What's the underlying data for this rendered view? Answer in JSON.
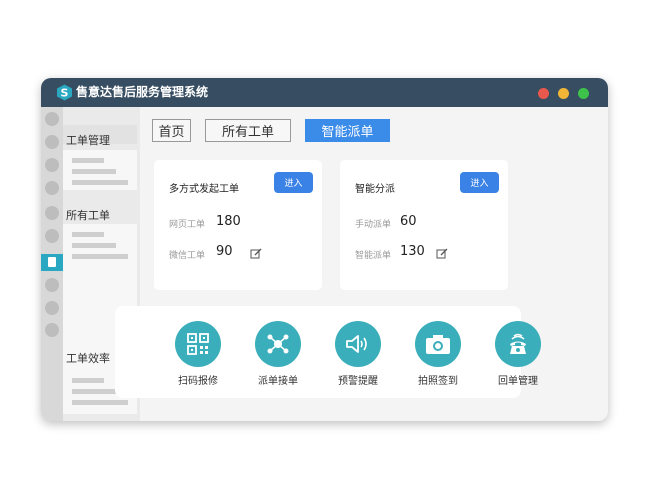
{
  "app": {
    "title": "售意达售后服务管理系统"
  },
  "window_controls": {
    "close_color": "#e9584d",
    "minimize_color": "#f2b637",
    "maximize_color": "#3ec34a"
  },
  "nav": {
    "sections": [
      {
        "label": "工单管理"
      },
      {
        "label": "所有工单"
      },
      {
        "label": "工单效率"
      }
    ]
  },
  "tabs": [
    {
      "label": "首页"
    },
    {
      "label": "所有工单"
    },
    {
      "label": "智能派单",
      "active": true
    }
  ],
  "cards": [
    {
      "title": "多方式发起工单",
      "button": "进入",
      "stats": [
        {
          "label": "网页工单",
          "value": "180"
        },
        {
          "label": "微信工单",
          "value": "90"
        }
      ]
    },
    {
      "title": "智能分派",
      "button": "进入",
      "stats": [
        {
          "label": "手动派单",
          "value": "60"
        },
        {
          "label": "智能派单",
          "value": "130"
        }
      ]
    }
  ],
  "tools": [
    {
      "label": "扫码报修",
      "icon": "qr-code-icon"
    },
    {
      "label": "派单接单",
      "icon": "network-nodes-icon"
    },
    {
      "label": "预警提醒",
      "icon": "speaker-icon"
    },
    {
      "label": "拍照签到",
      "icon": "camera-icon"
    },
    {
      "label": "回单管理",
      "icon": "telephone-icon"
    }
  ],
  "colors": {
    "accent": "#3b8be8",
    "tool_circle": "#3aaeba",
    "titlebar": "#364d62"
  }
}
